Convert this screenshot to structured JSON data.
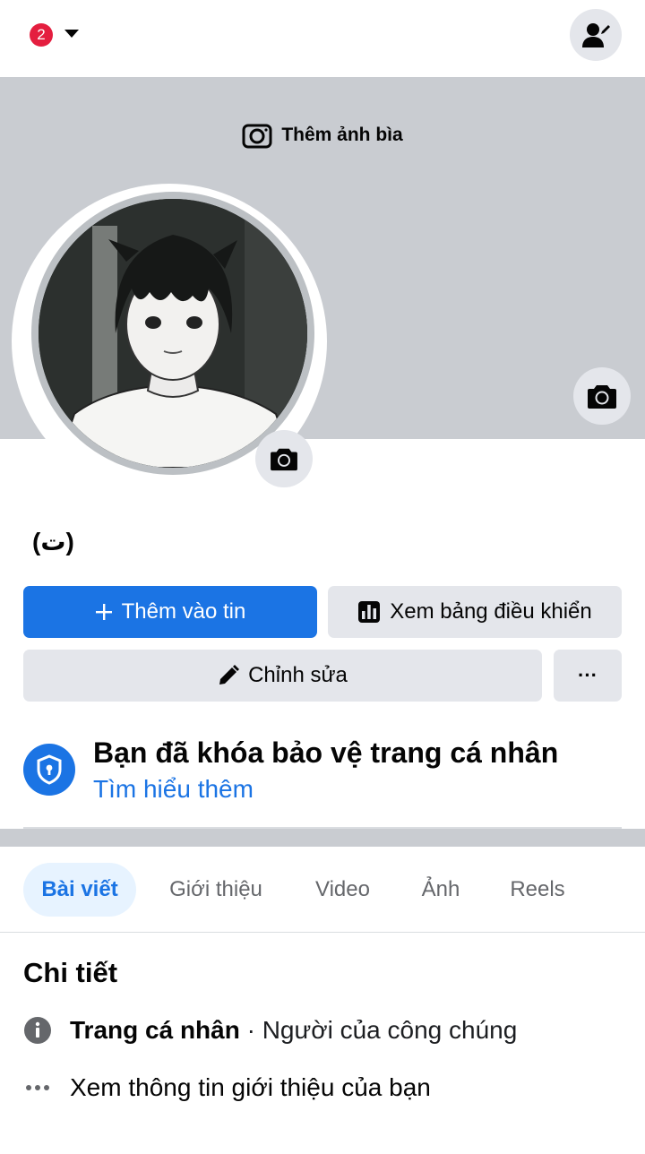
{
  "topbar": {
    "notification_count": "2"
  },
  "cover": {
    "add_cover_label": "Thêm ảnh bìa"
  },
  "profile": {
    "name": "(ت)"
  },
  "actions": {
    "add_story": "Thêm vào tin",
    "dashboard": "Xem bảng điều khiển",
    "edit": "Chỉnh sửa",
    "more": "···"
  },
  "profile_lock": {
    "title": "Bạn đã khóa bảo vệ trang cá nhân",
    "link": "Tìm hiểu thêm"
  },
  "tabs": [
    {
      "label": "Bài viết",
      "active": true
    },
    {
      "label": "Giới thiệu",
      "active": false
    },
    {
      "label": "Video",
      "active": false
    },
    {
      "label": "Ảnh",
      "active": false
    },
    {
      "label": "Reels",
      "active": false
    }
  ],
  "details": {
    "title": "Chi tiết",
    "profile_type_label": "Trang cá nhân",
    "profile_type_value": " · Người của công chúng",
    "see_about": "Xem thông tin giới thiệu của bạn"
  },
  "colors": {
    "accent": "#1b74e4",
    "badge": "#e41e3f",
    "cover_bg": "#c9ccd1",
    "button_bg": "#e4e6eb"
  }
}
